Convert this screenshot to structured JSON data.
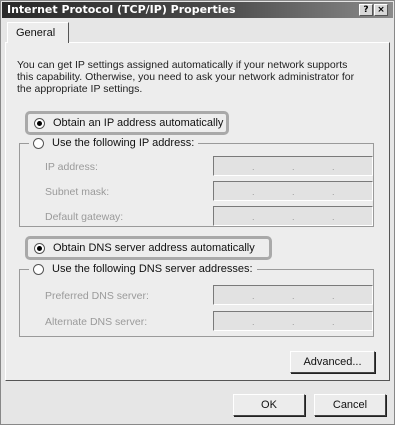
{
  "window": {
    "title": "Internet Protocol (TCP/IP) Properties",
    "help_button": "?",
    "close_button": "×"
  },
  "tabs": [
    {
      "label": "General",
      "selected": true
    }
  ],
  "description": {
    "line1": "You can get IP settings assigned automatically if your network supports",
    "line2": "this capability. Otherwise, you need to ask your network administrator for",
    "line3": "the appropriate IP settings."
  },
  "ip_section": {
    "auto_option": {
      "label": "Obtain an IP address automatically",
      "selected": true
    },
    "manual_option": {
      "label": "Use the following IP address:",
      "selected": false
    },
    "fields": [
      {
        "label": "IP address:",
        "value": ""
      },
      {
        "label": "Subnet mask:",
        "value": ""
      },
      {
        "label": "Default gateway:",
        "value": ""
      }
    ]
  },
  "dns_section": {
    "auto_option": {
      "label": "Obtain DNS server address automatically",
      "selected": true
    },
    "manual_option": {
      "label": "Use the following DNS server addresses:",
      "selected": false
    },
    "fields": [
      {
        "label": "Preferred DNS server:",
        "value": ""
      },
      {
        "label": "Alternate DNS server:",
        "value": ""
      }
    ]
  },
  "buttons": {
    "advanced": "Advanced...",
    "ok": "OK",
    "cancel": "Cancel"
  },
  "colors": {
    "highlight_outline": "#a9a9a9",
    "titlebar_start": "#2a2a2a",
    "disabled_text": "#9a9a9a"
  }
}
